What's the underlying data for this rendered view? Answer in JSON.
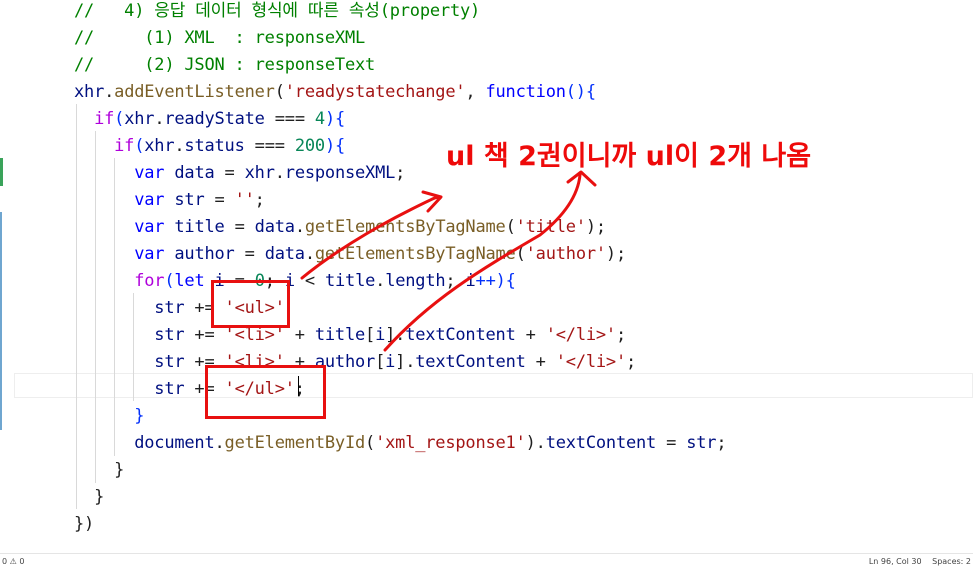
{
  "editor": {
    "lines": [
      [
        {
          "t": "//   4) 응답 데이터 형식에 따른 속성(property)",
          "c": "cm"
        }
      ],
      [
        {
          "t": "//     (1) XML  : responseXML",
          "c": "cm"
        }
      ],
      [
        {
          "t": "//     (2) JSON : responseText",
          "c": "cm"
        }
      ],
      [
        {
          "t": "xhr",
          "c": "var"
        },
        {
          "t": ".",
          "c": "pl"
        },
        {
          "t": "addEventListener",
          "c": "fn"
        },
        {
          "t": "(",
          "c": "pl"
        },
        {
          "t": "'readystatechange'",
          "c": "str"
        },
        {
          "t": ", ",
          "c": "pl"
        },
        {
          "t": "function",
          "c": "kw"
        },
        {
          "t": "(){",
          "c": "br"
        }
      ],
      [
        {
          "t": "  ",
          "c": "pl"
        },
        {
          "t": "if",
          "c": "ctl"
        },
        {
          "t": "(",
          "c": "br"
        },
        {
          "t": "xhr",
          "c": "var"
        },
        {
          "t": ".",
          "c": "pl"
        },
        {
          "t": "readyState",
          "c": "var"
        },
        {
          "t": " === ",
          "c": "pl"
        },
        {
          "t": "4",
          "c": "num"
        },
        {
          "t": "){",
          "c": "br"
        }
      ],
      [
        {
          "t": "    ",
          "c": "pl"
        },
        {
          "t": "if",
          "c": "ctl"
        },
        {
          "t": "(",
          "c": "br"
        },
        {
          "t": "xhr",
          "c": "var"
        },
        {
          "t": ".",
          "c": "pl"
        },
        {
          "t": "status",
          "c": "var"
        },
        {
          "t": " === ",
          "c": "pl"
        },
        {
          "t": "200",
          "c": "num"
        },
        {
          "t": "){",
          "c": "br"
        }
      ],
      [
        {
          "t": "      ",
          "c": "pl"
        },
        {
          "t": "var",
          "c": "kw"
        },
        {
          "t": " ",
          "c": "pl"
        },
        {
          "t": "data",
          "c": "var"
        },
        {
          "t": " = ",
          "c": "pl"
        },
        {
          "t": "xhr",
          "c": "var"
        },
        {
          "t": ".",
          "c": "pl"
        },
        {
          "t": "responseXML",
          "c": "var"
        },
        {
          "t": ";",
          "c": "pl"
        }
      ],
      [
        {
          "t": "      ",
          "c": "pl"
        },
        {
          "t": "var",
          "c": "kw"
        },
        {
          "t": " ",
          "c": "pl"
        },
        {
          "t": "str",
          "c": "var"
        },
        {
          "t": " = ",
          "c": "pl"
        },
        {
          "t": "''",
          "c": "str"
        },
        {
          "t": ";",
          "c": "pl"
        }
      ],
      [
        {
          "t": "      ",
          "c": "pl"
        },
        {
          "t": "var",
          "c": "kw"
        },
        {
          "t": " ",
          "c": "pl"
        },
        {
          "t": "title",
          "c": "var"
        },
        {
          "t": " = ",
          "c": "pl"
        },
        {
          "t": "data",
          "c": "var"
        },
        {
          "t": ".",
          "c": "pl"
        },
        {
          "t": "getElementsByTagName",
          "c": "fn"
        },
        {
          "t": "(",
          "c": "pl"
        },
        {
          "t": "'title'",
          "c": "str"
        },
        {
          "t": ");",
          "c": "pl"
        }
      ],
      [
        {
          "t": "      ",
          "c": "pl"
        },
        {
          "t": "var",
          "c": "kw"
        },
        {
          "t": " ",
          "c": "pl"
        },
        {
          "t": "author",
          "c": "var"
        },
        {
          "t": " = ",
          "c": "pl"
        },
        {
          "t": "data",
          "c": "var"
        },
        {
          "t": ".",
          "c": "pl"
        },
        {
          "t": "getElementsByTagName",
          "c": "fn"
        },
        {
          "t": "(",
          "c": "pl"
        },
        {
          "t": "'author'",
          "c": "str"
        },
        {
          "t": ");",
          "c": "pl"
        }
      ],
      [
        {
          "t": "      ",
          "c": "pl"
        },
        {
          "t": "for",
          "c": "ctl"
        },
        {
          "t": "(",
          "c": "br"
        },
        {
          "t": "let",
          "c": "kw"
        },
        {
          "t": " ",
          "c": "pl"
        },
        {
          "t": "i",
          "c": "var"
        },
        {
          "t": " = ",
          "c": "pl"
        },
        {
          "t": "0",
          "c": "num"
        },
        {
          "t": "; ",
          "c": "pl"
        },
        {
          "t": "i",
          "c": "var"
        },
        {
          "t": " < ",
          "c": "pl"
        },
        {
          "t": "title",
          "c": "var"
        },
        {
          "t": ".",
          "c": "pl"
        },
        {
          "t": "length",
          "c": "var"
        },
        {
          "t": "; ",
          "c": "pl"
        },
        {
          "t": "i",
          "c": "var"
        },
        {
          "t": "++){",
          "c": "br"
        }
      ],
      [
        {
          "t": "        ",
          "c": "pl"
        },
        {
          "t": "str",
          "c": "var"
        },
        {
          "t": " += ",
          "c": "pl"
        },
        {
          "t": "'<ul>'",
          "c": "str"
        }
      ],
      [
        {
          "t": "        ",
          "c": "pl"
        },
        {
          "t": "str",
          "c": "var"
        },
        {
          "t": " += ",
          "c": "pl"
        },
        {
          "t": "'<li>'",
          "c": "str"
        },
        {
          "t": " + ",
          "c": "pl"
        },
        {
          "t": "title",
          "c": "var"
        },
        {
          "t": "[",
          "c": "pl"
        },
        {
          "t": "i",
          "c": "var"
        },
        {
          "t": "].",
          "c": "pl"
        },
        {
          "t": "textContent",
          "c": "var"
        },
        {
          "t": " + ",
          "c": "pl"
        },
        {
          "t": "'</li>'",
          "c": "str"
        },
        {
          "t": ";",
          "c": "pl"
        }
      ],
      [
        {
          "t": "        ",
          "c": "pl"
        },
        {
          "t": "str",
          "c": "var"
        },
        {
          "t": " += ",
          "c": "pl"
        },
        {
          "t": "'<li>'",
          "c": "str"
        },
        {
          "t": " + ",
          "c": "pl"
        },
        {
          "t": "author",
          "c": "var"
        },
        {
          "t": "[",
          "c": "pl"
        },
        {
          "t": "i",
          "c": "var"
        },
        {
          "t": "].",
          "c": "pl"
        },
        {
          "t": "textContent",
          "c": "var"
        },
        {
          "t": " + ",
          "c": "pl"
        },
        {
          "t": "'</li>'",
          "c": "str"
        },
        {
          "t": ";",
          "c": "pl"
        }
      ],
      [
        {
          "t": "        ",
          "c": "pl"
        },
        {
          "t": "str",
          "c": "var"
        },
        {
          "t": " += ",
          "c": "pl"
        },
        {
          "t": "'</ul>'",
          "c": "str"
        },
        {
          "t": ";",
          "c": "pl"
        }
      ],
      [
        {
          "t": "      ",
          "c": "pl"
        },
        {
          "t": "}",
          "c": "br"
        }
      ],
      [
        {
          "t": "      ",
          "c": "pl"
        },
        {
          "t": "document",
          "c": "var"
        },
        {
          "t": ".",
          "c": "pl"
        },
        {
          "t": "getElementById",
          "c": "fn"
        },
        {
          "t": "(",
          "c": "pl"
        },
        {
          "t": "'xml_response1'",
          "c": "str"
        },
        {
          "t": ").",
          "c": "pl"
        },
        {
          "t": "textContent",
          "c": "var"
        },
        {
          "t": " = ",
          "c": "pl"
        },
        {
          "t": "str",
          "c": "var"
        },
        {
          "t": ";",
          "c": "pl"
        }
      ],
      [
        {
          "t": "    }",
          "c": "pl"
        }
      ],
      [
        {
          "t": "  }",
          "c": "pl"
        }
      ],
      [
        {
          "t": "})",
          "c": "pl"
        }
      ]
    ]
  },
  "annotation": {
    "text": "ul 책 2권이니까 ul이 2개 나옴",
    "color": "#ee0a0a"
  },
  "statusbar": {
    "problems": "0 ⚠ 0",
    "position": "Ln 96, Col 30",
    "spaces": "Spaces: 2"
  },
  "colors": {
    "comment": "#008000",
    "keyword": "#0000ff",
    "function": "#795e26",
    "string": "#a31515",
    "number": "#098658",
    "control": "#af00db",
    "variable": "#001080"
  }
}
